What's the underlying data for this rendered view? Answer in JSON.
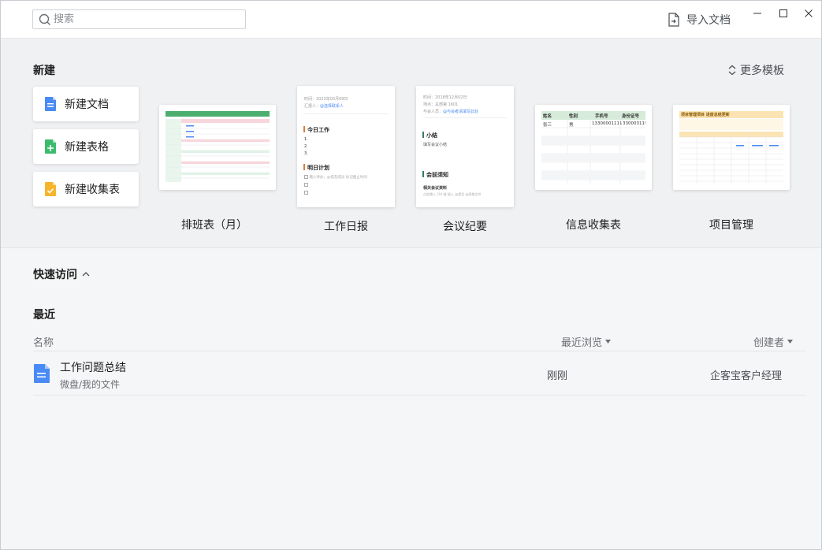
{
  "search": {
    "placeholder": "搜索"
  },
  "titlebar": {
    "import_label": "导入文档"
  },
  "new_section": {
    "title": "新建",
    "more_templates": "更多模板",
    "buttons": [
      {
        "label": "新建文档",
        "icon": "doc-icon",
        "color": "#4a8af4"
      },
      {
        "label": "新建表格",
        "icon": "sheet-icon",
        "color": "#3dbb6c"
      },
      {
        "label": "新建收集表",
        "icon": "form-icon",
        "color": "#f7b52c"
      }
    ],
    "templates": [
      {
        "label": "排班表（月）"
      },
      {
        "label": "工作日报",
        "date": "时间：2023年03月09日",
        "reporter_label": "汇报人：",
        "reporter": "@选择联系人",
        "h1": "今日工作",
        "h2": "明日计划",
        "todo_placeholder": "输入待办，@提及成员 标记截止时间"
      },
      {
        "label": "会议纪要",
        "date": "时间：2018年12月02日",
        "place": "地点：总部第 1601",
        "attendees_label": "与会人员：",
        "attendees": "@与会者请填写此处",
        "h1": "小结",
        "summary": "填写会议小结",
        "h2": "会前须知",
        "sub": "相关会议资料",
        "sub_line": "点此输入  Ctrl  链 插入 @提及 @表格文件"
      },
      {
        "label": "信息收集表",
        "headers": [
          "姓名",
          "性别",
          "手机号",
          "身份证号"
        ],
        "row1": [
          "张三",
          "男",
          "13300001111",
          "330003119901"
        ]
      },
      {
        "label": "项目管理",
        "title": "项目管理项目 进度总结更新"
      }
    ]
  },
  "quick_access": {
    "title": "快速访问"
  },
  "recent": {
    "title": "最近",
    "columns": {
      "name": "名称",
      "last_viewed": "最近浏览",
      "creator": "创建者"
    },
    "files": [
      {
        "name": "工作问题总结",
        "path": "微盘/我的文件",
        "time": "刚刚",
        "creator": "企客宝客户经理"
      }
    ]
  }
}
